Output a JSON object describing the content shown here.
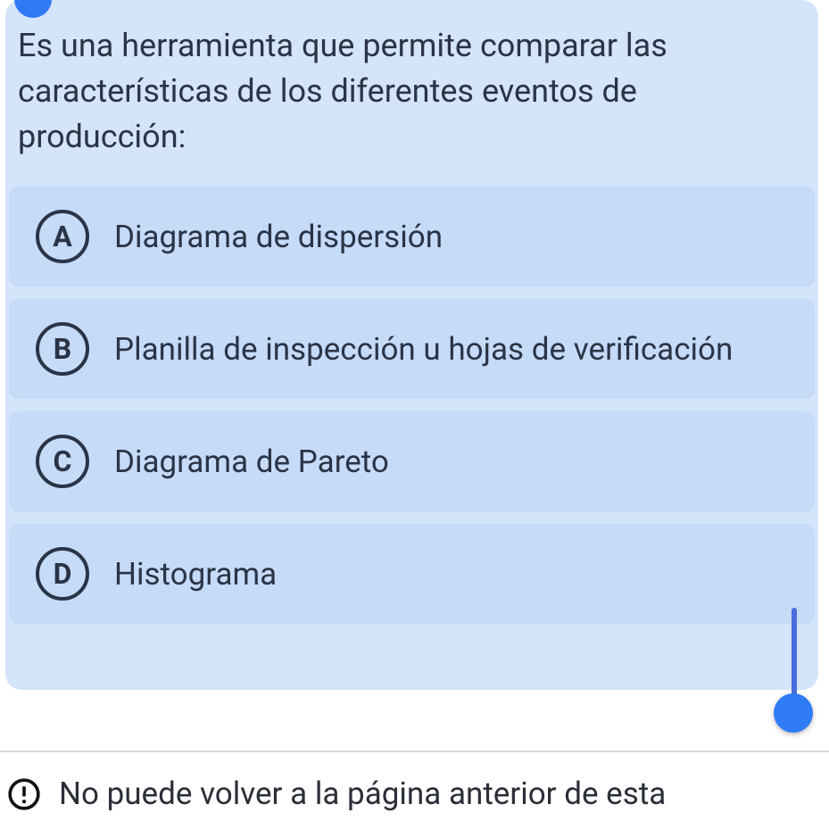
{
  "question": {
    "prompt": "Es una herramienta que permite comparar las características de los diferentes eventos de producción:",
    "options": [
      {
        "letter": "A",
        "text": "Diagrama de dispersión"
      },
      {
        "letter": "B",
        "text": "Planilla de inspección u hojas de verificación"
      },
      {
        "letter": "C",
        "text": "Diagrama de Pareto"
      },
      {
        "letter": "D",
        "text": "Histograma"
      }
    ]
  },
  "warning": {
    "text": "No puede volver a la página anterior de esta"
  }
}
